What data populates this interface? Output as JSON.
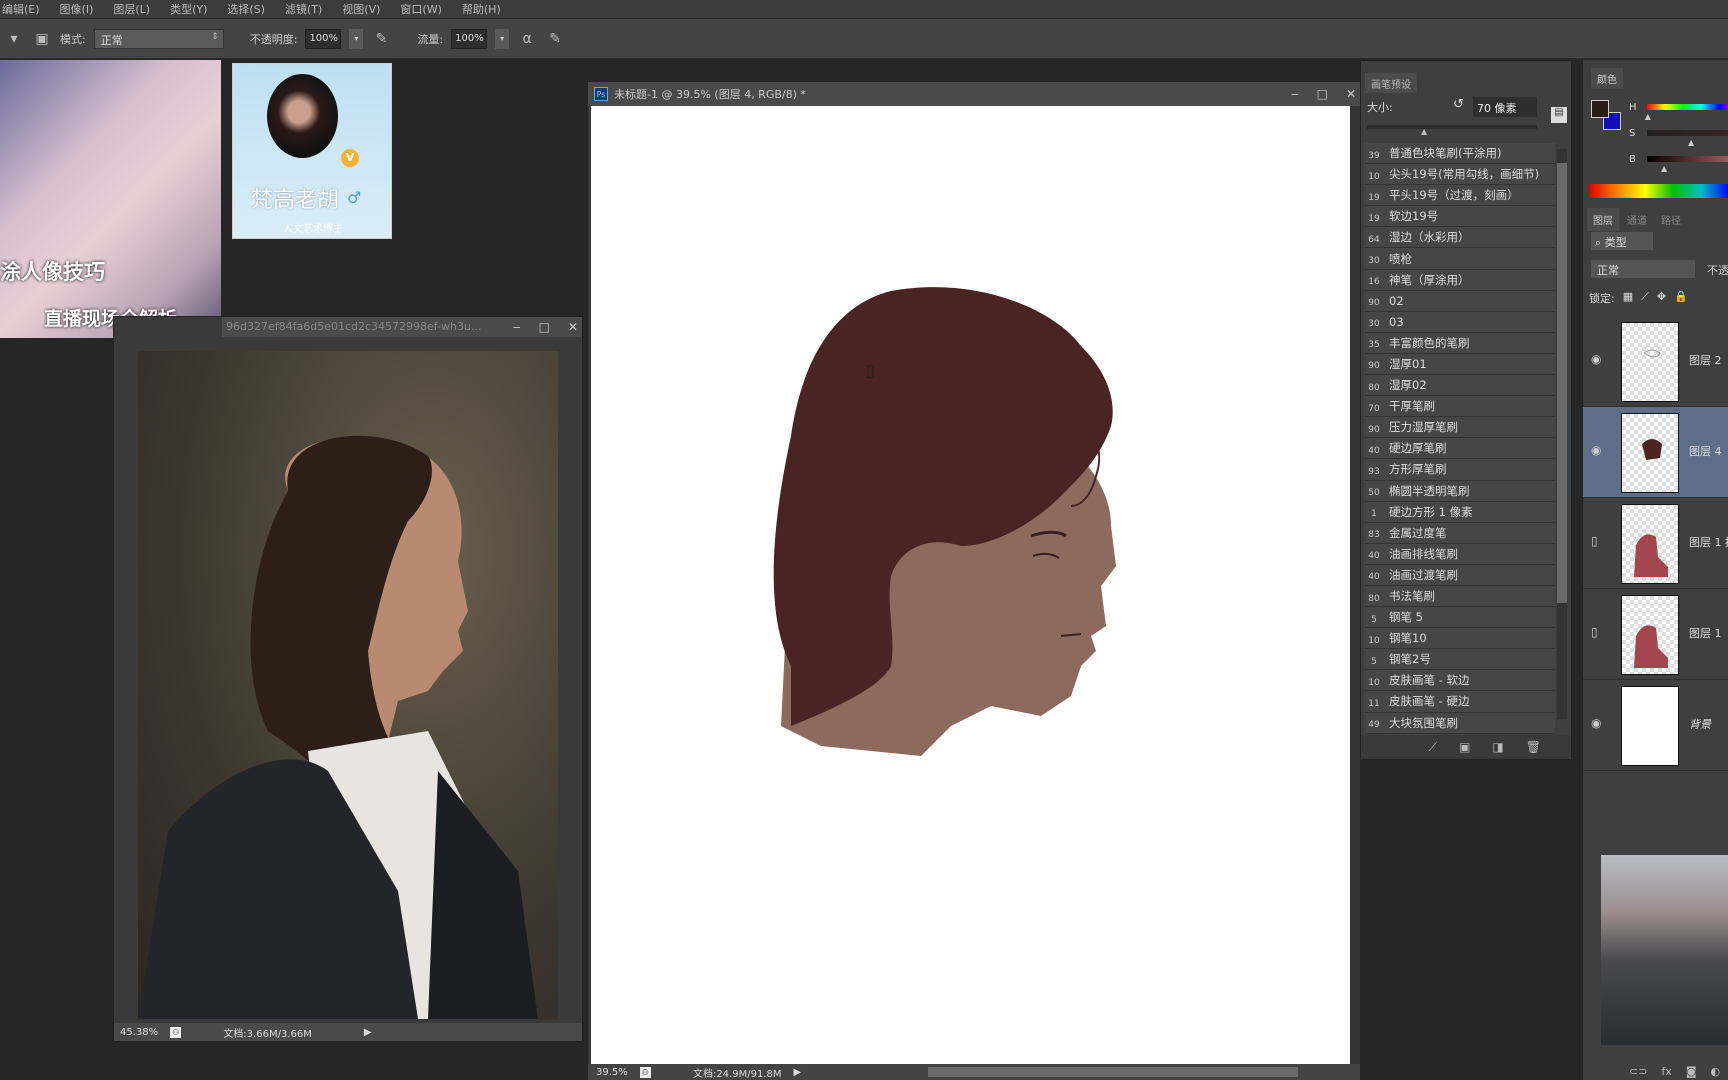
{
  "menu": [
    "编辑(E)",
    "图像(I)",
    "图层(L)",
    "类型(Y)",
    "选择(S)",
    "滤镜(T)",
    "视图(V)",
    "窗口(W)",
    "帮助(H)"
  ],
  "toolbar": {
    "mode_label": "模式:",
    "mode_value": "正常",
    "opacity_label": "不透明度:",
    "opacity_value": "100%",
    "flow_label": "流量:",
    "flow_value": "100%"
  },
  "thumbnail": {
    "line1": "涂人像技巧",
    "line2": "直播现场全解析"
  },
  "profile": {
    "name": "梵高老胡",
    "subtitle": "人文艺术博主",
    "badge": "V",
    "gender_icon": "male-icon"
  },
  "reference_window": {
    "title": "96d327ef84fa6d5e01cd2c34572998ef-wh3u...",
    "zoom": "45.38%",
    "doc_info": "文档:3.66M/3.66M"
  },
  "document_window": {
    "title": "未标题-1 @ 39.5% (图层 4, RGB/8) *",
    "zoom": "39.5%",
    "doc_info": "文档:24.9M/91.8M"
  },
  "brush_panel": {
    "tab": "画笔预设",
    "size_label": "大小:",
    "size_value": "70 像素",
    "brushes": [
      {
        "size": "39",
        "name": "普通色块笔刷(平涂用)"
      },
      {
        "size": "10",
        "name": "尖头19号(常用勾线，画细节)"
      },
      {
        "size": "19",
        "name": "平头19号（过渡，刻画）"
      },
      {
        "size": "19",
        "name": "软边19号"
      },
      {
        "size": "64",
        "name": "湿边（水彩用）"
      },
      {
        "size": "30",
        "name": "喷枪"
      },
      {
        "size": "16",
        "name": "神笔（厚涂用）"
      },
      {
        "size": "90",
        "name": "02"
      },
      {
        "size": "30",
        "name": "03"
      },
      {
        "size": "35",
        "name": "丰富颜色的笔刷"
      },
      {
        "size": "90",
        "name": "湿厚01"
      },
      {
        "size": "80",
        "name": "湿厚02"
      },
      {
        "size": "70",
        "name": "干厚笔刷"
      },
      {
        "size": "90",
        "name": "压力湿厚笔刷"
      },
      {
        "size": "40",
        "name": "硬边厚笔刷"
      },
      {
        "size": "93",
        "name": "方形厚笔刷"
      },
      {
        "size": "50",
        "name": "椭圆半透明笔刷"
      },
      {
        "size": "1",
        "name": "硬边方形 1 像素"
      },
      {
        "size": "83",
        "name": "金属过度笔"
      },
      {
        "size": "40",
        "name": "油画排线笔刷"
      },
      {
        "size": "40",
        "name": "油画过渡笔刷"
      },
      {
        "size": "80",
        "name": "书法笔刷"
      },
      {
        "size": "5",
        "name": "钢笔 5"
      },
      {
        "size": "10",
        "name": "钢笔10"
      },
      {
        "size": "5",
        "name": "钢笔2号"
      },
      {
        "size": "10",
        "name": "皮肤画笔 - 软边"
      },
      {
        "size": "11",
        "name": "皮肤画笔 - 硬边"
      },
      {
        "size": "49",
        "name": "大块氛围笔刷"
      }
    ]
  },
  "color_panel": {
    "tab": "颜色",
    "channels": [
      "H",
      "S",
      "B"
    ],
    "foreground": "#2a1c1c",
    "background": "#1010b0",
    "h_level": 0.02,
    "s_level": 0.5,
    "b_level": 0.2
  },
  "layers_panel": {
    "tabs": [
      "图层",
      "通道",
      "路径"
    ],
    "kind": "类型",
    "blend": "正常",
    "opacity_label": "不透",
    "lock_label": "锁定:",
    "layers": [
      {
        "name": "图层 2",
        "visible": true,
        "selected": false
      },
      {
        "name": "图层 4",
        "visible": true,
        "selected": true
      },
      {
        "name": "图层 1 拷",
        "visible": false,
        "selected": false
      },
      {
        "name": "图层 1",
        "visible": false,
        "selected": false
      },
      {
        "name": "背景",
        "visible": true,
        "selected": false
      }
    ]
  },
  "colors": {
    "hair": "#4a2422",
    "skin": "#8d6a5e",
    "selection": "#5e6e88"
  }
}
